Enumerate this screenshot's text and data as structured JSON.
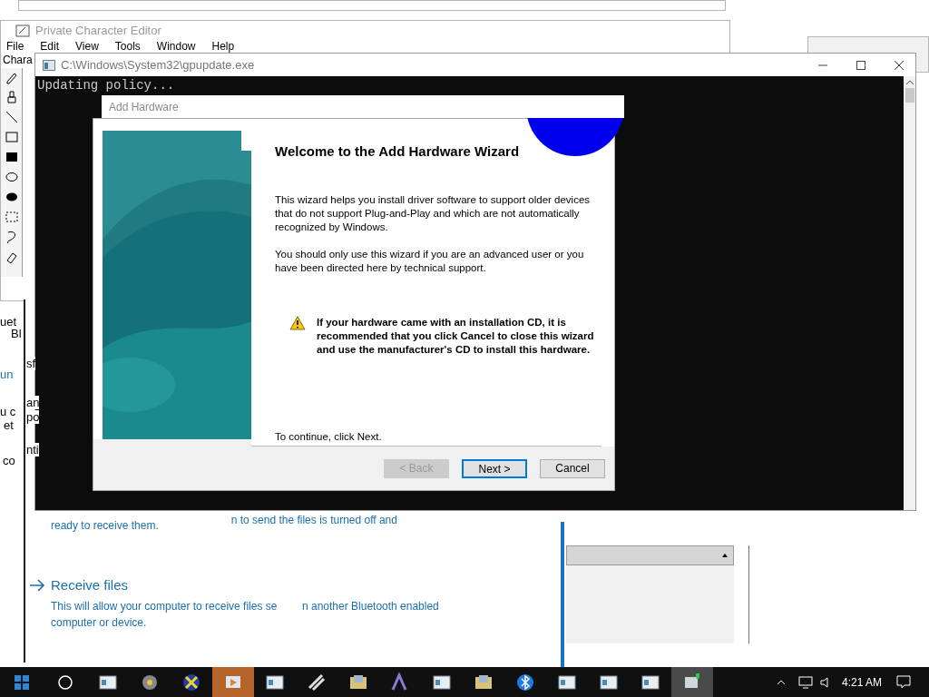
{
  "character_editor": {
    "title": "Private Character Editor",
    "menu": [
      "File",
      "Edit",
      "View",
      "Tools",
      "Window",
      "Help"
    ],
    "label": "Chara"
  },
  "side_fragments": [
    "Bl",
    "uet",
    "sf",
    "un",
    "an",
    "po",
    "u c",
    "et",
    "nti",
    "co"
  ],
  "bluetooth": {
    "line_1": "ready to receive them.",
    "line_2": "n to send the files is turned off and",
    "action_title": "Receive files",
    "action_text_1": "This will allow your computer to receive files se",
    "action_text_1b": "n another Bluetooth enabled",
    "action_text_2": "computer or device."
  },
  "console": {
    "title": "C:\\Windows\\System32\\gpupdate.exe",
    "output": "Updating policy..."
  },
  "wizard": {
    "title": "Add Hardware",
    "heading": "Welcome to the Add Hardware Wizard",
    "paragraphs": [
      "This wizard helps you install driver software to support older devices that do not support Plug-and-Play and which are not automatically recognized by Windows.",
      "You should only use this wizard if you are an advanced user or you have been directed here by technical support."
    ],
    "warning": "If your hardware came with an installation CD, it is recommended that you click Cancel to close this wizard and use the manufacturer's CD to install this hardware.",
    "footer": "To continue, click Next.",
    "buttons": [
      {
        "label": "< Back",
        "disabled": true,
        "default": false
      },
      {
        "label": "Next >",
        "disabled": false,
        "default": true
      },
      {
        "label": "Cancel",
        "disabled": false,
        "default": false
      }
    ]
  },
  "taskbar": {
    "clock": "4:21 AM",
    "apps": [
      {
        "kind": "app",
        "active": false
      },
      {
        "kind": "gear",
        "active": false
      },
      {
        "kind": "close",
        "active": false
      },
      {
        "kind": "media",
        "active": true
      },
      {
        "kind": "app",
        "active": false
      },
      {
        "kind": "tool",
        "active": false
      },
      {
        "kind": "folder",
        "active": false
      },
      {
        "kind": "font",
        "active": false
      },
      {
        "kind": "app",
        "active": false
      },
      {
        "kind": "folder",
        "active": false
      },
      {
        "kind": "bluetooth",
        "active": false
      },
      {
        "kind": "app",
        "active": false
      },
      {
        "kind": "app",
        "active": false
      },
      {
        "kind": "app",
        "active": false
      },
      {
        "kind": "network",
        "active": true
      }
    ]
  }
}
